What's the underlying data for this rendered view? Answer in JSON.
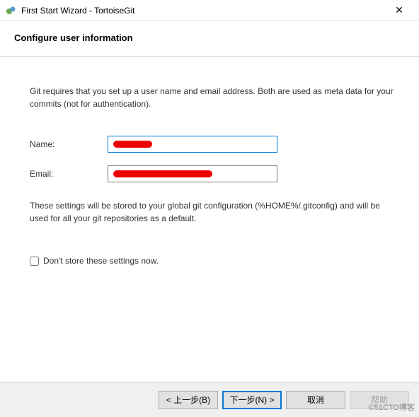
{
  "window": {
    "title": "First Start Wizard - TortoiseGit",
    "close": "✕"
  },
  "header": {
    "title": "Configure user information"
  },
  "body": {
    "intro": "Git requires that you set up a user name and email address. Both are used as meta data for your commits (not for authentication).",
    "name_label": "Name:",
    "name_value": "",
    "email_label": "Email:",
    "email_value": "",
    "note": "These settings will be stored to your global git configuration (%HOME%/.gitconfig) and will be used for all your git repositories as a default.",
    "checkbox_label": "Don't store these settings now."
  },
  "footer": {
    "back": "< 上一步(B)",
    "next": "下一步(N) >",
    "cancel": "取消",
    "help": "帮助"
  },
  "watermark": "©51CTO博客"
}
